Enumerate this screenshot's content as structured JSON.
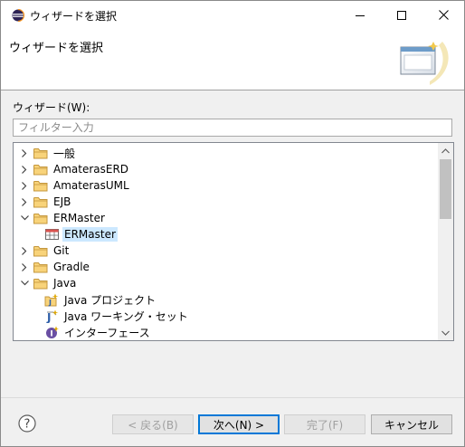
{
  "window": {
    "title": "ウィザードを選択"
  },
  "banner": {
    "title": "ウィザードを選択"
  },
  "filter": {
    "label": "ウィザード(W):",
    "placeholder": "フィルター入力",
    "value": ""
  },
  "tree": {
    "items": [
      {
        "label": "一般",
        "kind": "folder",
        "expanded": false
      },
      {
        "label": "AmaterasERD",
        "kind": "folder",
        "expanded": false
      },
      {
        "label": "AmaterasUML",
        "kind": "folder",
        "expanded": false
      },
      {
        "label": "EJB",
        "kind": "folder",
        "expanded": false
      },
      {
        "label": "ERMaster",
        "kind": "folder",
        "expanded": true
      },
      {
        "label": "ERMaster",
        "kind": "table-icon",
        "selected": true
      },
      {
        "label": "Git",
        "kind": "folder",
        "expanded": false
      },
      {
        "label": "Gradle",
        "kind": "folder",
        "expanded": false
      },
      {
        "label": "Java",
        "kind": "folder",
        "expanded": true
      },
      {
        "label": "Java プロジェクト",
        "kind": "java-project-icon"
      },
      {
        "label": "Java ワーキング・セット",
        "kind": "java-working-set-icon"
      },
      {
        "label": "インターフェース",
        "kind": "interface-icon"
      }
    ]
  },
  "buttons": {
    "back": "< 戻る(B)",
    "next": "次へ(N) >",
    "finish": "完了(F)",
    "cancel": "キャンセル"
  },
  "colors": {
    "selection": "#cce8ff",
    "folder": "#dcb35c",
    "default_button_border": "#0078d7"
  }
}
